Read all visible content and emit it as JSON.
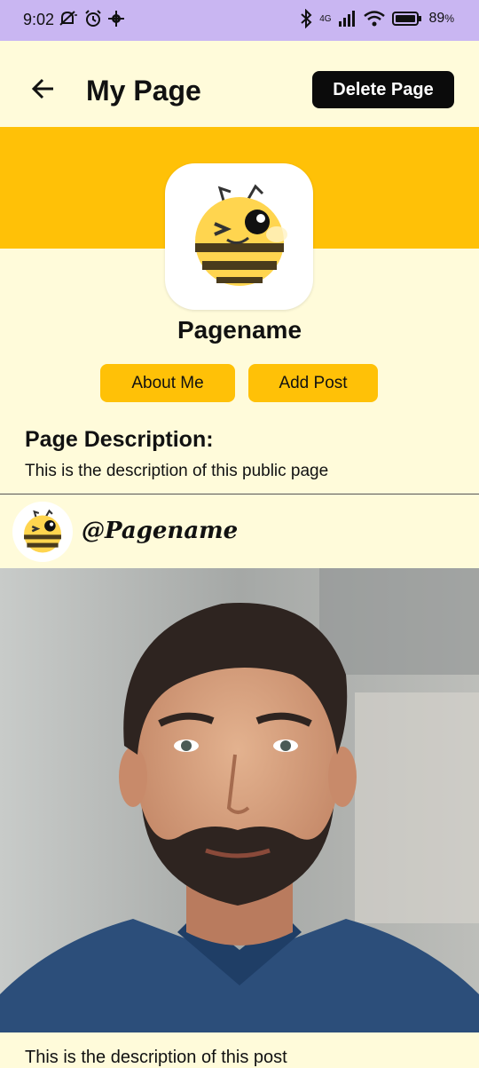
{
  "status_bar": {
    "time": "9:02",
    "network": "4G",
    "battery": "89",
    "battery_unit": "%"
  },
  "header": {
    "title": "My Page",
    "delete_label": "Delete Page"
  },
  "profile": {
    "name": "Pagename",
    "about_label": "About Me",
    "add_post_label": "Add Post"
  },
  "description": {
    "heading": "Page Description:",
    "text": "This is the description of this public page"
  },
  "post": {
    "handle": "@Pagename",
    "caption": "This is the description of this post"
  },
  "colors": {
    "status_bar": "#C9B6F2",
    "background": "#FFFBDA",
    "accent": "#FFC107",
    "button_dark": "#0B0B0B"
  },
  "icons": [
    "back-arrow-icon",
    "bee-logo-icon",
    "bluetooth-icon",
    "signal-icon",
    "wifi-icon",
    "battery-icon",
    "alarm-icon",
    "gear-icon"
  ]
}
